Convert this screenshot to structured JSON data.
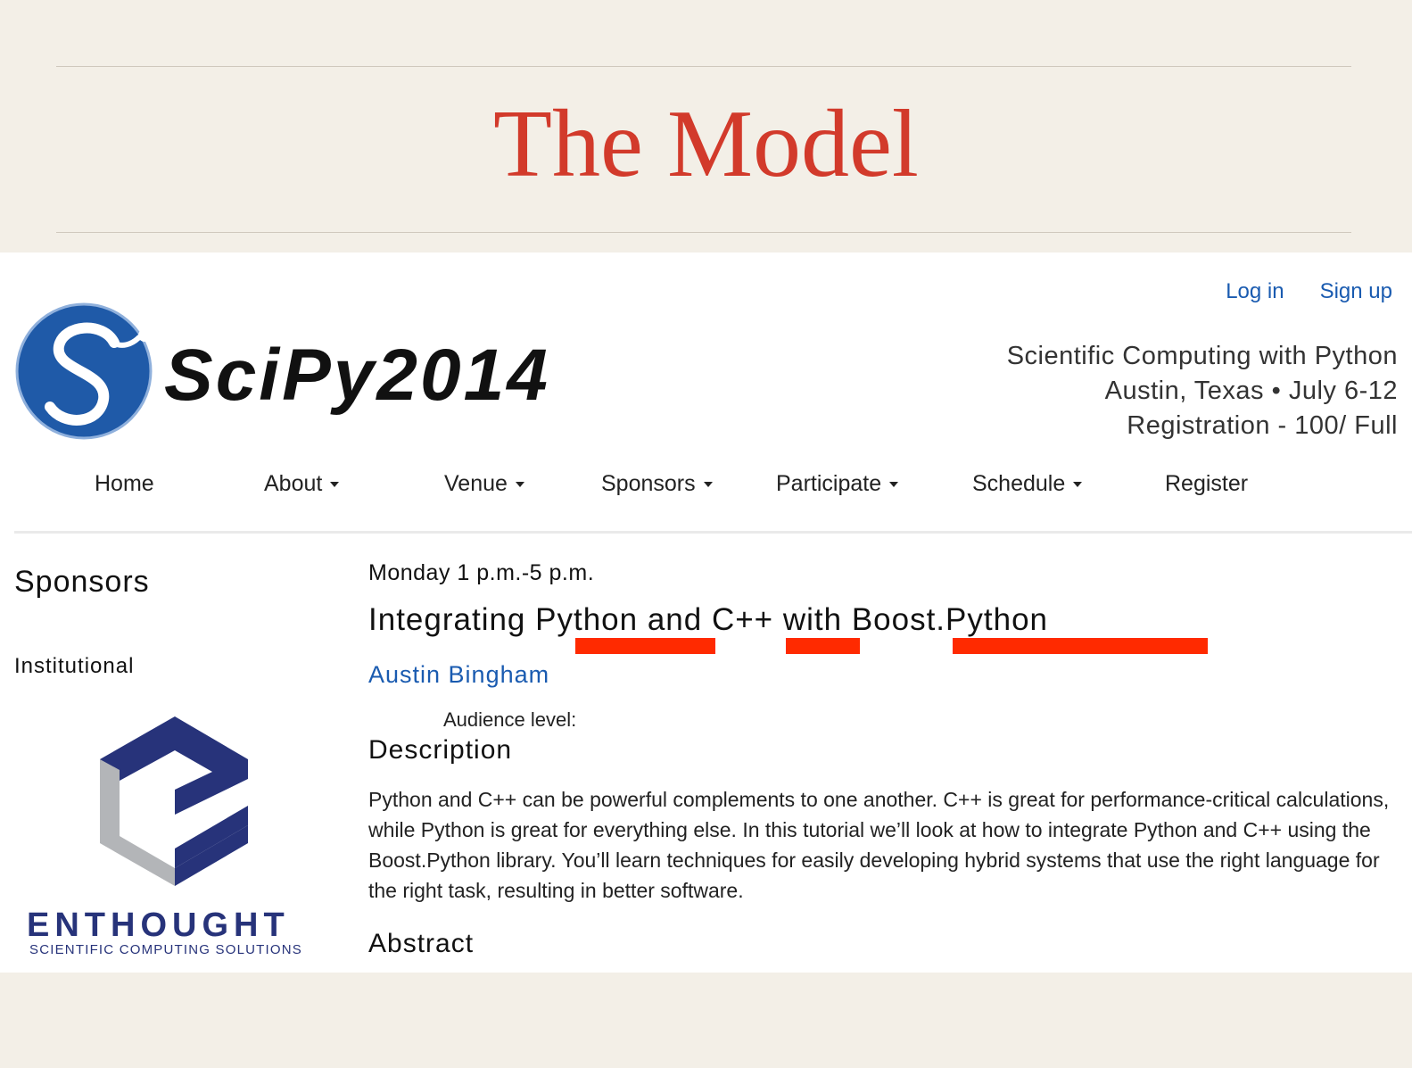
{
  "slide": {
    "title": "The Model"
  },
  "header": {
    "login_label": "Log in",
    "signup_label": "Sign up",
    "logo_text": "SciPy2014",
    "tagline": [
      "Scientific Computing with Python",
      "Austin, Texas • July 6-12",
      "Registration - 100/ Full"
    ]
  },
  "nav": {
    "items": [
      {
        "label": "Home",
        "dropdown": false
      },
      {
        "label": "About",
        "dropdown": true
      },
      {
        "label": "Venue",
        "dropdown": true
      },
      {
        "label": "Sponsors",
        "dropdown": true
      },
      {
        "label": "Participate",
        "dropdown": true
      },
      {
        "label": "Schedule",
        "dropdown": true
      },
      {
        "label": "Register",
        "dropdown": false
      }
    ]
  },
  "sidebar": {
    "title": "Sponsors",
    "subtitle": "Institutional",
    "sponsor_name": "ENTHOUGHT",
    "sponsor_tagline": "SCIENTIFIC COMPUTING SOLUTIONS"
  },
  "talk": {
    "time": "Monday 1 p.m.-5 p.m.",
    "title_parts": [
      "Integrating ",
      "Python",
      " and ",
      "C++",
      " with ",
      "Boost.Python"
    ],
    "speaker": "Austin Bingham",
    "audience_label": "Audience level:",
    "description_heading": "Description",
    "description": "Python and C++ can be powerful complements to one another. C++ is great for performance-critical calculations, while Python is great for everything else. In this tutorial we’ll look at how to integrate Python and C++ using the Boost.Python library. You’ll learn techniques for easily developing hybrid systems that use the right language for the right task, resulting in better software.",
    "abstract_heading": "Abstract"
  },
  "colors": {
    "slide_title": "#d23a2b",
    "link": "#1a5bb0",
    "highlight": "#ff2a00",
    "scipy_blue": "#1f5aa8",
    "enthought_navy": "#27337a",
    "enthought_gray": "#b3b5b8"
  }
}
